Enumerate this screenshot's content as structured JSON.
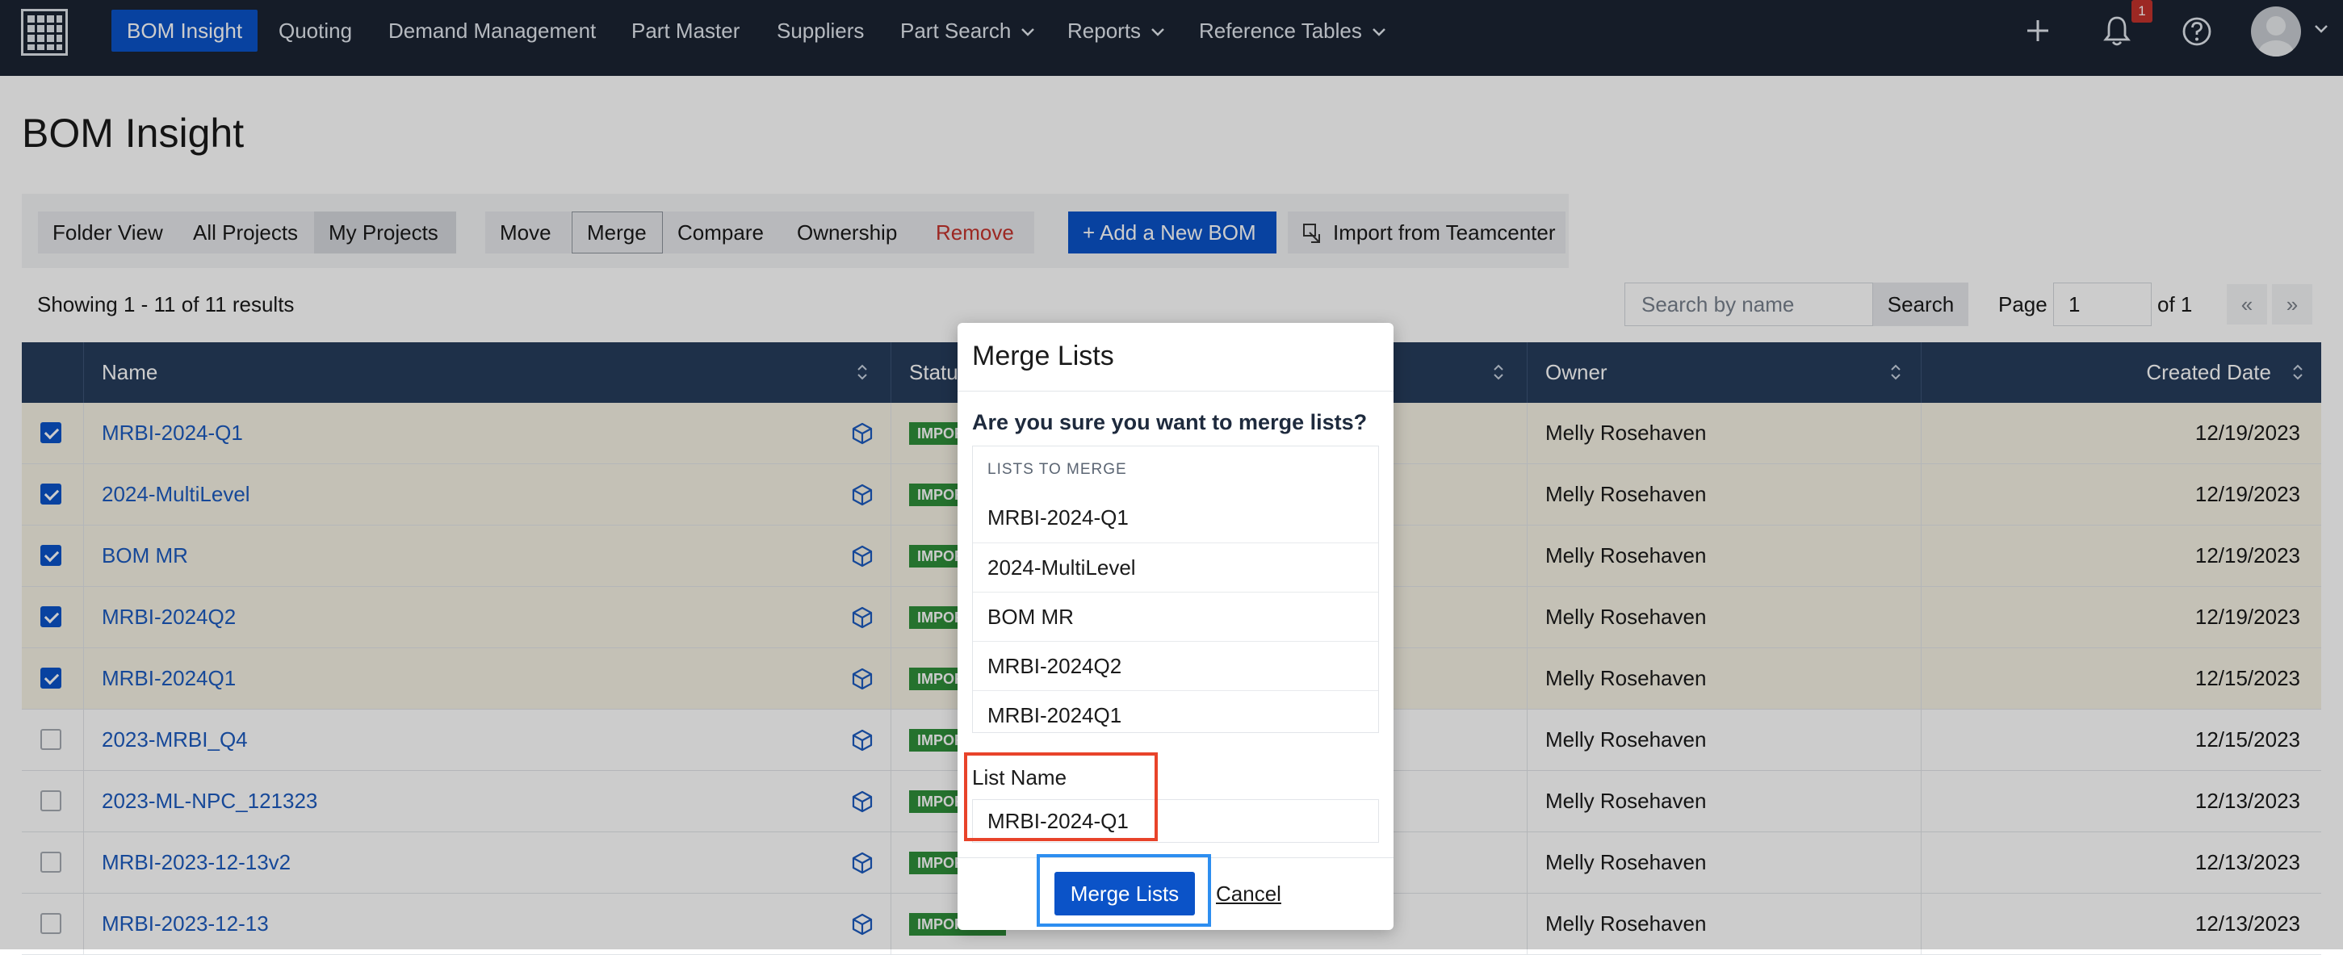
{
  "nav": {
    "items": [
      {
        "label": "BOM Insight",
        "active": true
      },
      {
        "label": "Quoting"
      },
      {
        "label": "Demand Management"
      },
      {
        "label": "Part Master"
      },
      {
        "label": "Suppliers"
      },
      {
        "label": "Part Search",
        "dropdown": true
      },
      {
        "label": "Reports",
        "dropdown": true
      },
      {
        "label": "Reference Tables",
        "dropdown": true
      }
    ],
    "notification_count": "1",
    "icons": [
      "grid-logo-icon",
      "plus-icon",
      "bell-icon",
      "help-icon",
      "avatar-icon",
      "chevron-down-icon"
    ]
  },
  "page": {
    "title": "BOM Insight"
  },
  "toolbar": {
    "folder_view": "Folder View",
    "all_projects": "All Projects",
    "my_projects": "My Projects",
    "move": "Move",
    "merge": "Merge",
    "compare": "Compare",
    "ownership": "Ownership",
    "remove": "Remove",
    "add_bom": "+ Add a New BOM",
    "import": "Import from Teamcenter"
  },
  "results": {
    "showing": "Showing 1 - 11 of 11 results",
    "search_placeholder": "Search by name",
    "search_button": "Search",
    "page_label": "Page",
    "page_value": "1",
    "page_of": "of 1",
    "prev": "«",
    "next": "»"
  },
  "table": {
    "headers": {
      "name": "Name",
      "status": "Status",
      "owner": "Owner",
      "created": "Created Date"
    },
    "rows": [
      {
        "name": "MRBI-2024-Q1",
        "checked": true,
        "status": "IMPORTED",
        "owner": "Melly Rosehaven",
        "date": "12/19/2023"
      },
      {
        "name": "2024-MultiLevel",
        "checked": true,
        "status": "IMPORTED",
        "owner": "Melly Rosehaven",
        "date": "12/19/2023"
      },
      {
        "name": "BOM MR",
        "checked": true,
        "status": "IMPORTED",
        "owner": "Melly Rosehaven",
        "date": "12/19/2023"
      },
      {
        "name": "MRBI-2024Q2",
        "checked": true,
        "status": "IMPORTED",
        "owner": "Melly Rosehaven",
        "date": "12/19/2023"
      },
      {
        "name": "MRBI-2024Q1",
        "checked": true,
        "status": "IMPORTED",
        "owner": "Melly Rosehaven",
        "date": "12/15/2023"
      },
      {
        "name": "2023-MRBI_Q4",
        "checked": false,
        "status": "IMPORTED",
        "owner": "Melly Rosehaven",
        "date": "12/15/2023"
      },
      {
        "name": "2023-ML-NPC_121323",
        "checked": false,
        "status": "IMPORTED",
        "owner": "Melly Rosehaven",
        "date": "12/13/2023"
      },
      {
        "name": "MRBI-2023-12-13v2",
        "checked": false,
        "status": "IMPORTED",
        "owner": "Melly Rosehaven",
        "date": "12/13/2023"
      },
      {
        "name": "MRBI-2023-12-13",
        "checked": false,
        "status": "IMPORTED",
        "owner": "Melly Rosehaven",
        "date": "12/13/2023"
      }
    ]
  },
  "modal": {
    "title": "Merge Lists",
    "question": "Are you sure you want to merge lists?",
    "lists_header": "LISTS TO MERGE",
    "lists": [
      "MRBI-2024-Q1",
      "2024-MultiLevel",
      "BOM MR",
      "MRBI-2024Q2",
      "MRBI-2024Q1"
    ],
    "list_name_label": "List Name",
    "list_name_value": "MRBI-2024-Q1",
    "merge_button": "Merge Lists",
    "cancel": "Cancel"
  },
  "colors": {
    "nav_bg": "#1b2433",
    "accent": "#0b53c8",
    "table_header": "#263c5c",
    "status_green": "#2f8f3a",
    "danger": "#c4332c",
    "highlight_red": "#e8432a",
    "highlight_blue": "#2d8ef0"
  }
}
